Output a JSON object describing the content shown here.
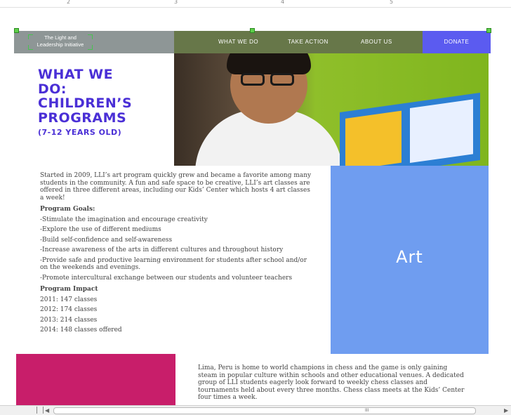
{
  "ruler": {
    "marks": [
      "2",
      "3",
      "4",
      "5"
    ]
  },
  "header": {
    "logo_line1": "The Light and",
    "logo_line2": "Leadership Initiative",
    "nav": [
      "WHAT WE DO",
      "TAKE ACTION",
      "ABOUT US"
    ],
    "donate": "DONATE"
  },
  "page": {
    "title_line1": "WHAT WE",
    "title_line2": "DO:",
    "title_line3": "CHILDREN’S",
    "title_line4": "PROGRAMS",
    "subtitle": "(7-12 YEARS OLD)"
  },
  "art": {
    "intro": "Started in 2009, LLI’s art program quickly grew and became a favorite among many students in the community. A fun and safe space to be creative, LLI’s art classes are offered in three different areas, including our Kids’ Center which hosts 4 art classes a week!",
    "goals_title": "Program Goals:",
    "goals": [
      "-Stimulate the imagination and encourage creativity",
      "-Explore the use of different mediums",
      "-Build self-confidence and self-awareness",
      "-Increase awareness of the arts in different cultures and throughout history",
      "-Provide safe and productive learning environment for students after school and/or on the weekends and evenings.",
      "-Promote intercultural exchange between our students and volunteer teachers"
    ],
    "impact_title": "Program Impact",
    "impact": [
      "2011: 147 classes",
      "2012: 174 classes",
      "2013: 214 classes",
      "2014: 148 classes offered"
    ],
    "panel_label": "Art",
    "panel_color": "#6f9df0"
  },
  "chess": {
    "text": "Lima, Peru is home to world champions in chess and the game is only gaining steam in popular culture within schools and other educational venues. A dedicated group of LLI students eagerly look forward to weekly chess classes and tournaments held about every three months. Chess class meets at the Kids’ Center four times a week.",
    "panel_color": "#c81e6a"
  },
  "scrollbar": {
    "grip": "III"
  }
}
